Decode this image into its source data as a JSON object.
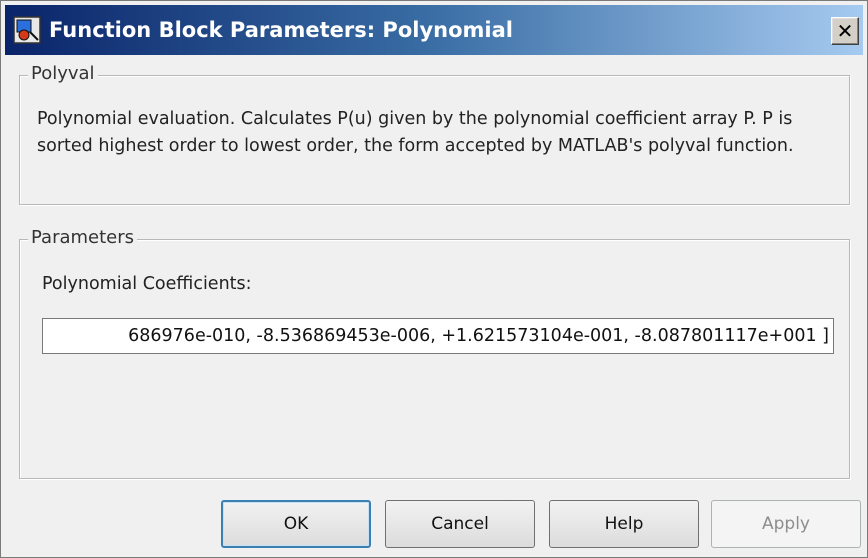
{
  "window": {
    "title": "Function Block Parameters: Polynomial",
    "close_label": "✕"
  },
  "polyval": {
    "group_label": "Polyval",
    "description": "Polynomial evaluation.  Calculates P(u) given by the polynomial coefficient array P. P is sorted highest order to lowest order, the form accepted by MATLAB's polyval function."
  },
  "parameters": {
    "group_label": "Parameters",
    "coefficients_label": "Polynomial Coefficients:",
    "coefficients_value": "686976e-010, -8.536869453e-006, +1.621573104e-001, -8.087801117e+001 ]"
  },
  "buttons": {
    "ok": "OK",
    "cancel": "Cancel",
    "help": "Help",
    "apply": "Apply"
  },
  "colors": {
    "title_gradient_start": "#0a246a",
    "title_gradient_end": "#a6caf0",
    "dialog_bg": "#f0f0f0"
  }
}
